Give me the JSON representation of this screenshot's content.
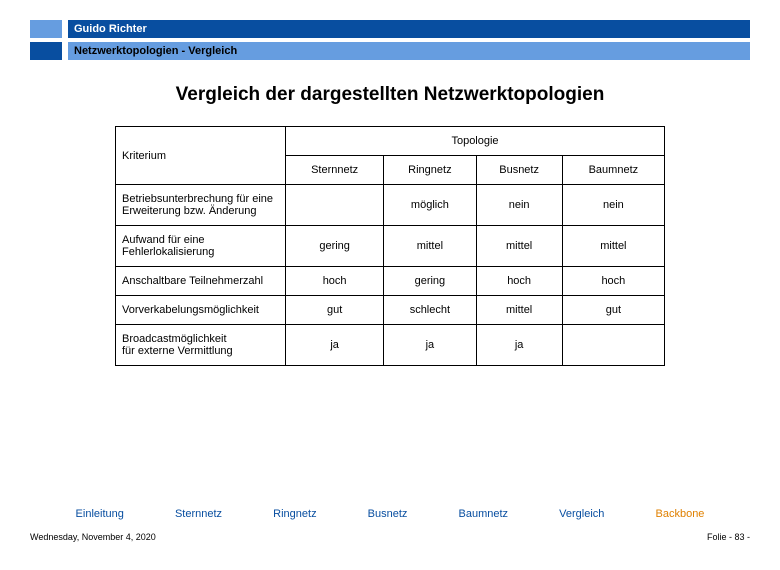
{
  "header": {
    "author": "Guido Richter",
    "subtitle": "Netzwerktopologien  - Vergleich"
  },
  "title": "Vergleich der dargestellten Netzwerktopologien",
  "table": {
    "criterion_label": "Kriterium",
    "topology_label": "Topologie",
    "columns": [
      "Sternnetz",
      "Ringnetz",
      "Busnetz",
      "Baumnetz"
    ],
    "rows": [
      {
        "criterion": "Betriebsunterbrechung für eine Erweiterung bzw. Änderung",
        "values": [
          "",
          "möglich",
          "nein",
          "nein"
        ]
      },
      {
        "criterion": "Aufwand für eine Fehlerlokalisierung",
        "values": [
          "gering",
          "mittel",
          "mittel",
          "mittel"
        ]
      },
      {
        "criterion": "Anschaltbare Teilnehmerzahl",
        "values": [
          "hoch",
          "gering",
          "hoch",
          "hoch"
        ]
      },
      {
        "criterion": "Vorverkabelungsmöglichkeit",
        "values": [
          "gut",
          "schlecht",
          "mittel",
          "gut"
        ]
      },
      {
        "criterion": "Broadcastmöglichkeit\nfür externe Vermittlung",
        "values": [
          "ja",
          "ja",
          "ja",
          ""
        ]
      }
    ]
  },
  "nav": {
    "items": [
      "Einleitung",
      "Sternnetz",
      "Ringnetz",
      "Busnetz",
      "Baumnetz",
      "Vergleich",
      "Backbone"
    ],
    "active_index": 6
  },
  "footer": {
    "date": "Wednesday, November 4, 2020",
    "page": "Folie - 83 -"
  },
  "chart_data": {
    "type": "table",
    "title": "Vergleich der dargestellten Netzwerktopologien",
    "columns": [
      "Kriterium",
      "Sternnetz",
      "Ringnetz",
      "Busnetz",
      "Baumnetz"
    ],
    "rows": [
      [
        "Betriebsunterbrechung für eine Erweiterung bzw. Änderung",
        "",
        "möglich",
        "nein",
        "nein"
      ],
      [
        "Aufwand für eine Fehlerlokalisierung",
        "gering",
        "mittel",
        "mittel",
        "mittel"
      ],
      [
        "Anschaltbare Teilnehmerzahl",
        "hoch",
        "gering",
        "hoch",
        "hoch"
      ],
      [
        "Vorverkabelungsmöglichkeit",
        "gut",
        "schlecht",
        "mittel",
        "gut"
      ],
      [
        "Broadcastmöglichkeit für externe Vermittlung",
        "ja",
        "ja",
        "ja",
        ""
      ]
    ]
  }
}
